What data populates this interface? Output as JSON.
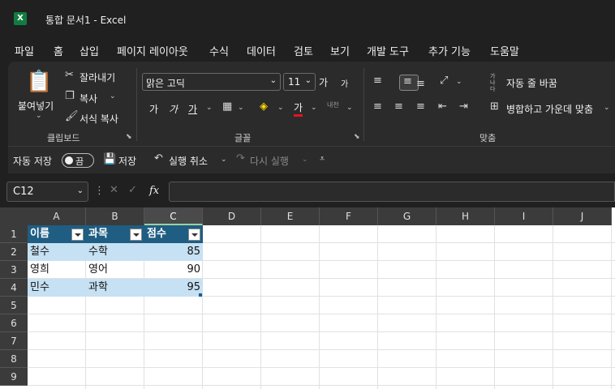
{
  "window": {
    "title": "통합 문서1  -  Excel",
    "app_icon_letter": "X"
  },
  "menu_tabs": [
    "파일",
    "홈",
    "삽입",
    "페이지 레이아웃",
    "수식",
    "데이터",
    "검토",
    "보기",
    "개발 도구",
    "추가 기능",
    "도움말"
  ],
  "ribbon": {
    "clipboard": {
      "paste": "붙여넣기",
      "cut": "잘라내기",
      "copy": "복사",
      "format_painter": "서식 복사",
      "label": "클립보드"
    },
    "font": {
      "name": "맑은 고딕",
      "size": "11",
      "grow": "가",
      "shrink": "가",
      "bold": "가",
      "italic": "가",
      "underline": "가",
      "font_color_glyph": "가",
      "phonetic": "내천",
      "label": "글꼴"
    },
    "alignment": {
      "wrap_text": "자동 줄 바꿈",
      "merge_center": "병합하고 가운데 맞춤",
      "label": "맞춤",
      "rotate_glyph": "가나다"
    }
  },
  "qat": {
    "autosave": "자동 저장",
    "autosave_state": "끔",
    "save": "저장",
    "undo": "실행 취소",
    "redo": "다시 실행"
  },
  "formula_bar": {
    "name_box": "C12",
    "fx": "fx",
    "value": ""
  },
  "columns": [
    "A",
    "B",
    "C",
    "D",
    "E",
    "F",
    "G",
    "H",
    "I",
    "J"
  ],
  "rows": [
    "1",
    "2",
    "3",
    "4",
    "5",
    "6",
    "7",
    "8",
    "9"
  ],
  "table": {
    "headers": [
      "이름",
      "과목",
      "점수"
    ],
    "rows": [
      [
        "철수",
        "수학",
        "85"
      ],
      [
        "영희",
        "영어",
        "90"
      ],
      [
        "민수",
        "과학",
        "95"
      ]
    ]
  },
  "colors": {
    "accent": "#5fb4ef",
    "table_header": "#1f5d82",
    "table_band": "#c6e1f3",
    "excel_green": "#107c41"
  }
}
